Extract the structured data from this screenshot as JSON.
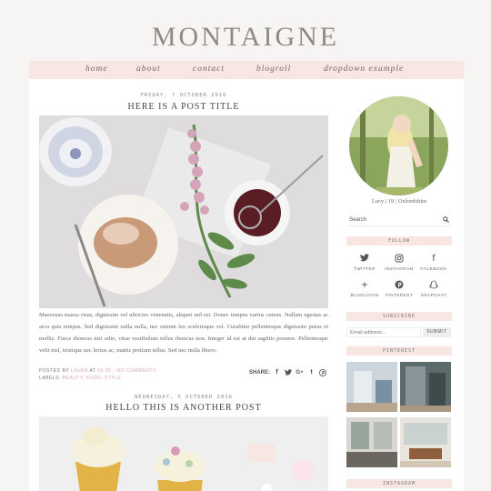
{
  "blog": {
    "title": "MONTAIGNE"
  },
  "nav": [
    "home",
    "about",
    "contact",
    "blogroll",
    "dropdown example"
  ],
  "posts": [
    {
      "date": "FRIDAY, 7 OCTOBER 2016",
      "title": "HERE IS A POST TITLE",
      "excerpt": "Maecenas massa risus, dignissim vel ultricies venenatis, aliquet sed est. Donec tempus varius cursus. Nullam egestas ac arcu quis tempus. Sed dignissim nulla nulla, nec rutrum leo scelerisque vel. Curabitur pellentesque dignissim purus et mollis. Fusce rhoncus nisi odio, vitae vestibulum tellus rhoncus non. Integer id est at dui sagittis posuere. Pellentesque velit nisl, tristique nec lectus ac, mattis pretium tellus. Sed nec nulla libero.",
      "posted_by_label": "POSTED BY",
      "author": "LAURA",
      "at_label": "AT",
      "time": "09:30",
      "comments": "NO COMMENTS",
      "labels_label": "LABELS:",
      "labels": "BEAUTY, FOOD, STYLE",
      "share_label": "SHARE:"
    },
    {
      "date": "WEDNESDAY, 5 OCTOBER 2016",
      "title": "HELLO THIS IS ANOTHER POST"
    }
  ],
  "share_icons": [
    "facebook-icon",
    "twitter-icon",
    "google-plus-icon",
    "tumblr-icon",
    "pinterest-icon"
  ],
  "sidebar": {
    "caption": "Lucy | 19 | Oxfordshire",
    "search_placeholder": "Search",
    "follow_title": "FOLLOW",
    "social": [
      {
        "label": "TWITTER",
        "icon": "twitter-icon"
      },
      {
        "label": "INSTAGRAM",
        "icon": "instagram-icon"
      },
      {
        "label": "FACEBOOK",
        "icon": "facebook-icon"
      },
      {
        "label": "BLOGLOVIN",
        "icon": "bloglovin-icon"
      },
      {
        "label": "PINTEREST",
        "icon": "pinterest-icon"
      },
      {
        "label": "SNAPCHAT",
        "icon": "snapchat-icon"
      }
    ],
    "subscribe_title": "SUBSCRIBE",
    "email_placeholder": "Email address...",
    "submit_label": "SUBMIT",
    "pinterest_title": "PINTEREST",
    "instagram_title": "INSTAGRAM"
  },
  "colors": {
    "accent": "#f7e6e1",
    "link": "#d9a9a9",
    "text": "#555555"
  }
}
